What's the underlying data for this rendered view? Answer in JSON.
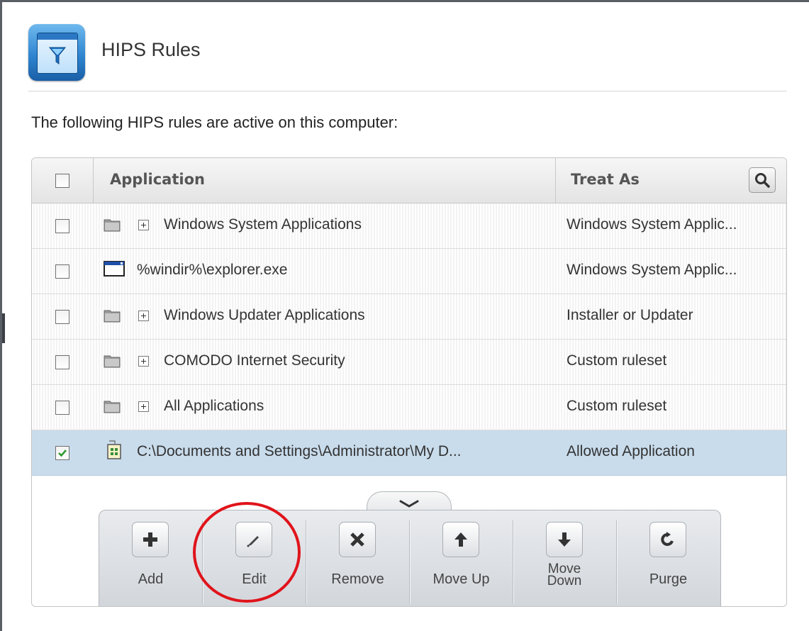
{
  "header": {
    "title": "HIPS Rules",
    "icon": "hips-funnel-icon"
  },
  "intro": "The following HIPS rules are active on this computer:",
  "table": {
    "columns": [
      "Application",
      "Treat As"
    ],
    "rows": [
      {
        "name": "Windows System Applications",
        "treat_as": "Windows System Applic...",
        "icon": "folder-icon",
        "expandable": true,
        "checked": false
      },
      {
        "name": "%windir%\\explorer.exe",
        "treat_as": "Windows System Applic...",
        "icon": "executable-icon",
        "expandable": false,
        "checked": false
      },
      {
        "name": "Windows Updater Applications",
        "treat_as": "Installer or Updater",
        "icon": "folder-icon",
        "expandable": true,
        "checked": false
      },
      {
        "name": "COMODO Internet Security",
        "treat_as": "Custom ruleset",
        "icon": "folder-icon",
        "expandable": true,
        "checked": false
      },
      {
        "name": "All Applications",
        "treat_as": "Custom ruleset",
        "icon": "folder-icon",
        "expandable": true,
        "checked": false
      },
      {
        "name": "C:\\Documents and Settings\\Administrator\\My D...",
        "treat_as": "Allowed Application",
        "icon": "application-icon",
        "expandable": false,
        "checked": true,
        "selected": true
      }
    ]
  },
  "toolbar": {
    "buttons": [
      {
        "label": "Add",
        "icon": "plus-icon"
      },
      {
        "label": "Edit",
        "icon": "pencil-icon"
      },
      {
        "label": "Remove",
        "icon": "x-icon"
      },
      {
        "label": "Move Up",
        "icon": "arrow-up-icon"
      },
      {
        "label": "Move Down",
        "icon": "arrow-down-icon"
      },
      {
        "label": "Purge",
        "icon": "refresh-icon"
      }
    ]
  },
  "colors": {
    "selected_row": "#c9dcec",
    "highlight_annotation": "#e0141b",
    "checkmark": "#2e9a2e"
  }
}
